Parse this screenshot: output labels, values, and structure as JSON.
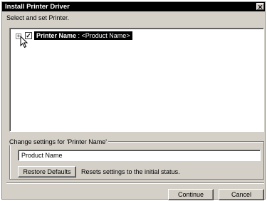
{
  "window": {
    "title": "Install Printer Driver",
    "close_glyph": "✕"
  },
  "instruction": "Select and set Printer.",
  "tree": {
    "expander": "+",
    "checked": true,
    "check_glyph": "✓",
    "item_bold": "Printer Name",
    "item_rest": " : <Product Name>"
  },
  "settings": {
    "group_label": "Change settings for 'Printer Name'",
    "name_value": "Product Name",
    "restore_button": "Restore Defaults",
    "restore_description": "Resets settings to the initial status."
  },
  "buttons": {
    "continue": "Continue",
    "cancel": "Cancel"
  },
  "icons": [
    "close-icon",
    "expand-icon",
    "checkbox-checked-icon",
    "mouse-cursor-icon"
  ]
}
